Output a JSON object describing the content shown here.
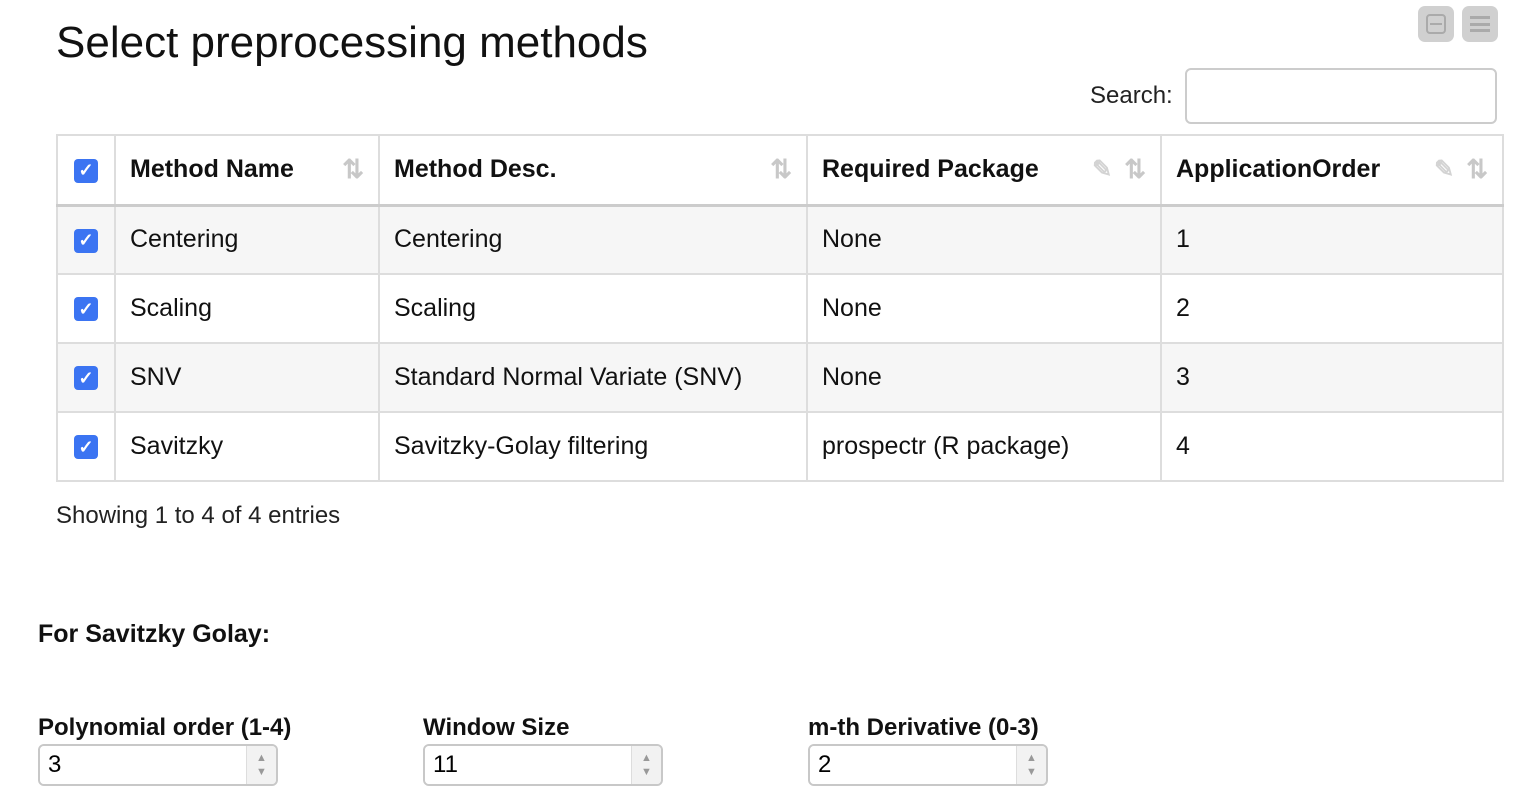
{
  "title": "Select preprocessing methods",
  "search": {
    "label": "Search:",
    "value": "",
    "placeholder": ""
  },
  "table": {
    "headers": [
      "Method Name",
      "Method Desc.",
      "Required Package",
      "ApplicationOrder"
    ],
    "rows": [
      {
        "name": "Centering",
        "desc": "Centering",
        "package": "None",
        "order": "1",
        "checked": true
      },
      {
        "name": "Scaling",
        "desc": "Scaling",
        "package": "None",
        "order": "2",
        "checked": true
      },
      {
        "name": "SNV",
        "desc": "Standard Normal Variate (SNV)",
        "package": "None",
        "order": "3",
        "checked": true
      },
      {
        "name": "Savitzky",
        "desc": "Savitzky-Golay filtering",
        "package": "prospectr (R package)",
        "order": "4",
        "checked": true
      }
    ]
  },
  "info": "Showing 1 to 4 of 4 entries",
  "savitzky": {
    "title": "For Savitzky Golay:",
    "fields": [
      {
        "label": "Polynomial order (1-4)",
        "value": "3"
      },
      {
        "label": "Window Size",
        "value": "11"
      },
      {
        "label": "m-th Derivative (0-3)",
        "value": "2"
      }
    ]
  },
  "icons": {
    "checkbox": "✓",
    "sort": "⇅",
    "edit": "✎",
    "spin_up": "▲",
    "spin_down": "▼"
  },
  "colors": {
    "checkbox": "#3b74f2"
  }
}
